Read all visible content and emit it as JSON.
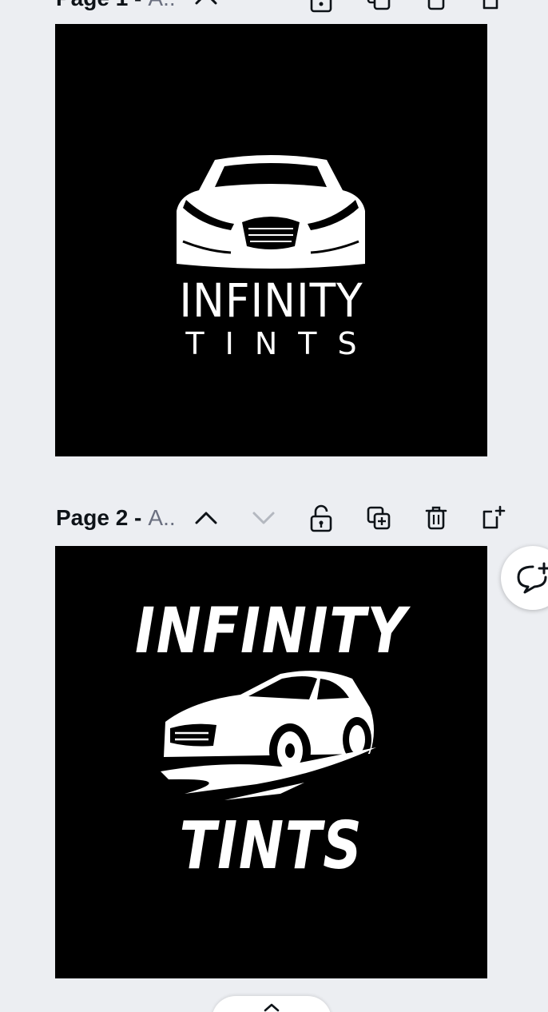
{
  "pages": [
    {
      "title": "Page 1 -",
      "subtitle": "A..",
      "design": {
        "line1": "INFINITY",
        "line2": "TINTS"
      }
    },
    {
      "title": "Page 2 -",
      "subtitle": "A..",
      "design": {
        "line1": "INFINITY",
        "line2": "TINTS"
      }
    }
  ],
  "icons": {
    "move_up": "chevron-up-icon",
    "move_down": "chevron-down-icon",
    "lock": "unlock-icon",
    "duplicate": "duplicate-icon",
    "delete": "trash-icon",
    "add_page": "add-page-icon",
    "comment": "add-comment-icon",
    "expand": "chevron-up-icon"
  },
  "colors": {
    "background": "#eceef2",
    "canvas": "#000000",
    "text_primary": "#0e1318",
    "text_secondary": "#6b7080",
    "icon": "#0e1318",
    "icon_disabled": "#b4b8c0"
  }
}
